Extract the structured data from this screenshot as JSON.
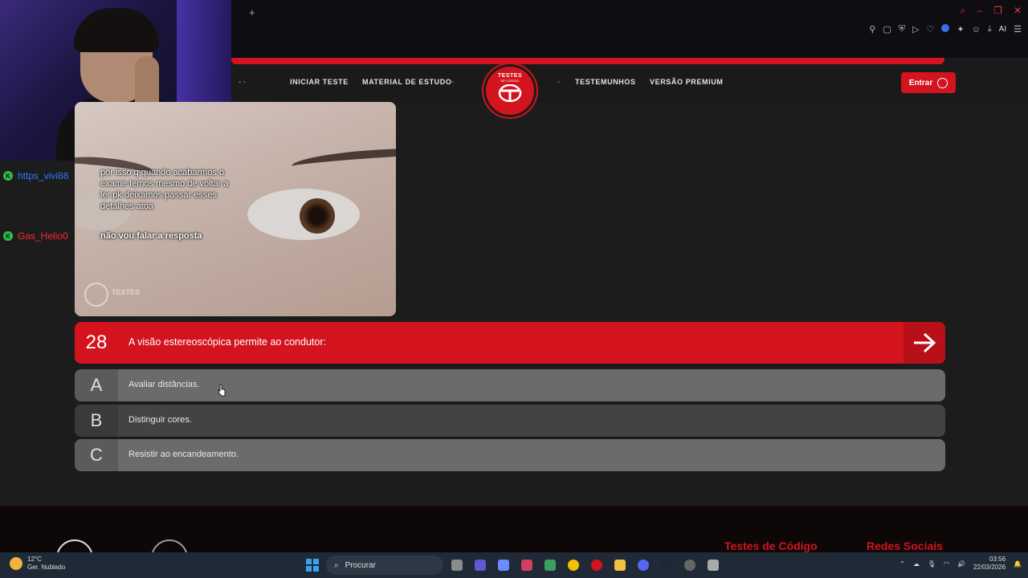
{
  "browser": {
    "new_tab_glyph": "+",
    "ai_label": "AI"
  },
  "nav": {
    "items": [
      "INICIAR TESTE",
      "MATERIAL DE ESTUDO",
      "TESTEMUNHOS",
      "VERSÃO PREMIUM"
    ],
    "logo_text": "TESTES",
    "logo_sub": "DE CÓDIGO",
    "login_label": "Entrar"
  },
  "chat": {
    "users": [
      "https_vivi88",
      "Gas_Helio0"
    ],
    "messages": [
      "por isso q quando acabarmos o exame temos mesmo de voltar a ler pk deixamos passar esses detalhes atoa",
      "não vou falar a resposta"
    ]
  },
  "image": {
    "watermark": "TESTES"
  },
  "question": {
    "number": "28",
    "text": "A visão estereoscópica permite ao condutor:"
  },
  "options": [
    {
      "letter": "A",
      "text": "Avaliar distâncias."
    },
    {
      "letter": "B",
      "text": "Distinguir cores."
    },
    {
      "letter": "C",
      "text": "Resistir ao encandeamento."
    }
  ],
  "footer": {
    "col1": "Testes de Código",
    "col2": "Redes Sociais"
  },
  "taskbar": {
    "temperature": "12°C",
    "weather": "Ger. Nublado",
    "search_label": "Procurar",
    "time": "03:56",
    "date": "22/03/2026"
  },
  "colors": {
    "brand_red": "#d3141e",
    "option_bg": "#6b6b6b",
    "chat_user1": "#2e7cff",
    "chat_user2": "#ff2a2a"
  }
}
